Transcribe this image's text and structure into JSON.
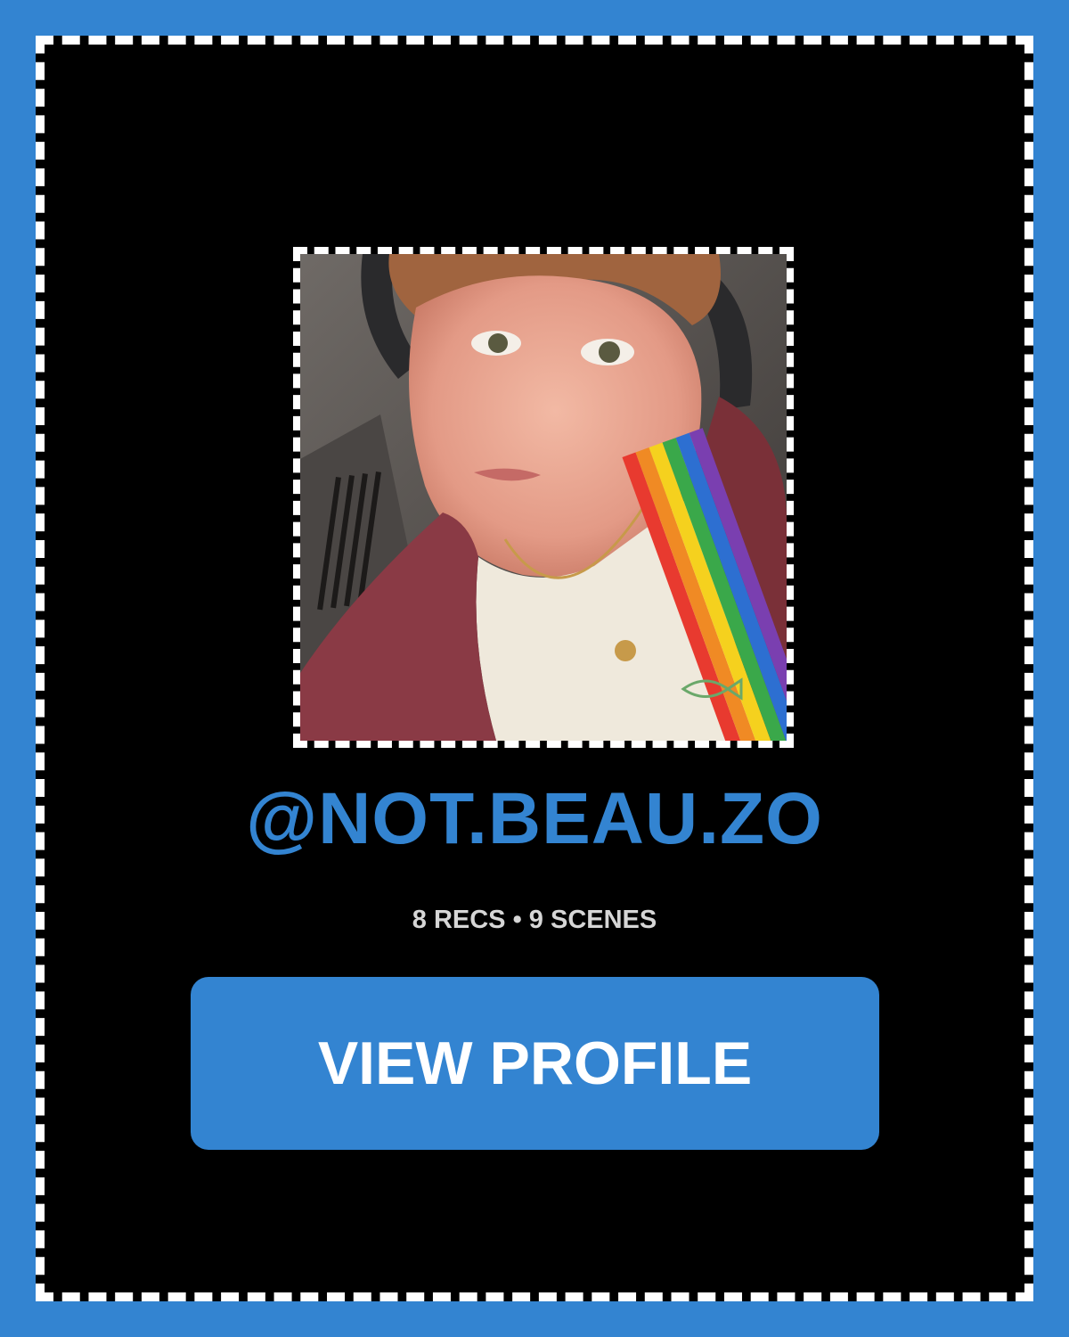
{
  "colors": {
    "page_background": "#3384d1",
    "card_background": "#000000",
    "accent": "#3384d1",
    "button_text": "#ffffff",
    "stats_text": "#d6d6d6"
  },
  "profile": {
    "handle": "@NOT.BEAU.ZO",
    "stats": "8 RECS • 9 SCENES",
    "photo_alt": "Profile photo"
  },
  "actions": {
    "view_profile_label": "VIEW PROFILE"
  }
}
